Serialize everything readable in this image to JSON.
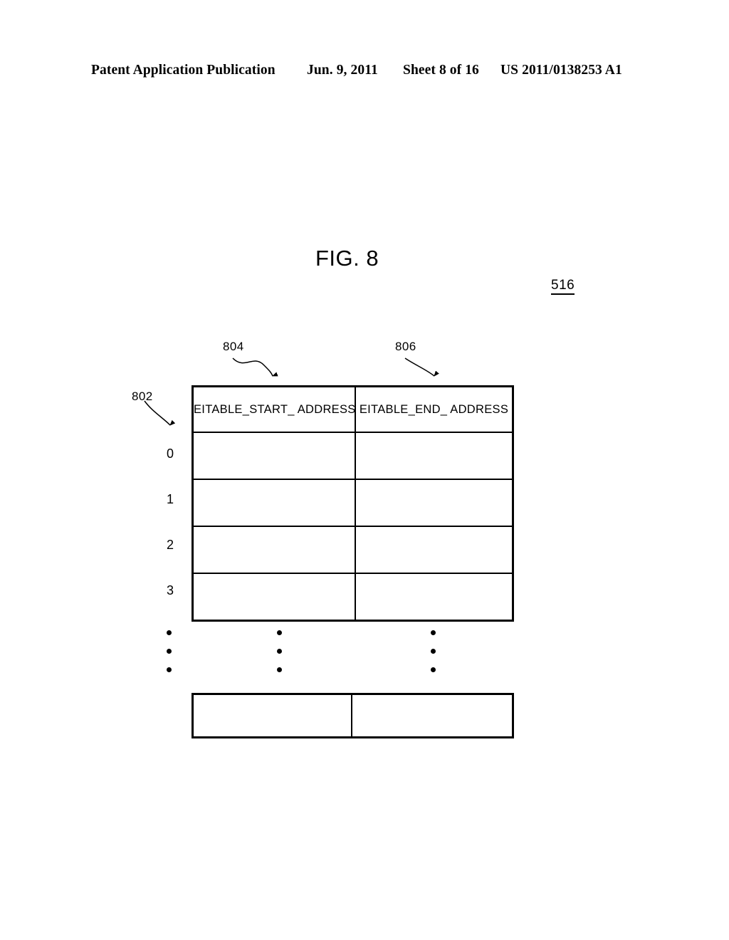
{
  "page_header": {
    "publication": "Patent Application Publication",
    "date": "Jun. 9, 2011",
    "sheet": "Sheet 8 of 16",
    "patent_number": "US 2011/0138253 A1"
  },
  "figure": {
    "title": "FIG. 8",
    "figure_reference": "516"
  },
  "reference_numerals": {
    "table_rows_pointer": "802",
    "start_address_column_pointer": "804",
    "end_address_column_pointer": "806"
  },
  "table": {
    "columns": [
      {
        "header": "EITABLE_START_ ADDRESS",
        "ref": "804"
      },
      {
        "header": "EITABLE_END_ ADDRESS",
        "ref": "806"
      }
    ],
    "row_indices": [
      "0",
      "1",
      "2",
      "3"
    ],
    "rows": [
      {
        "index": "0",
        "start_address": "",
        "end_address": ""
      },
      {
        "index": "1",
        "start_address": "",
        "end_address": ""
      },
      {
        "index": "2",
        "start_address": "",
        "end_address": ""
      },
      {
        "index": "3",
        "start_address": "",
        "end_address": ""
      }
    ],
    "continuation_indicator": "vertical-ellipsis",
    "continuation_row": {
      "start_address": "",
      "end_address": ""
    }
  },
  "colors": {
    "line": "#000000",
    "background": "#ffffff"
  }
}
